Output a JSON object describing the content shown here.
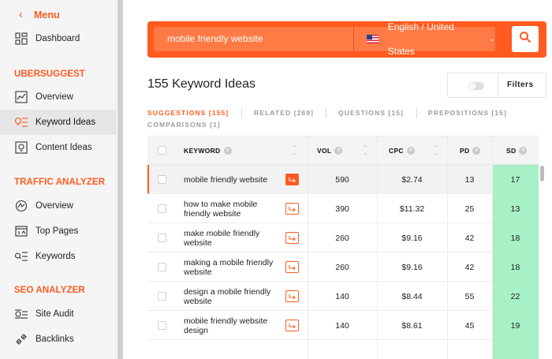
{
  "menu": {
    "label": "Menu"
  },
  "nav": {
    "dashboard": "Dashboard",
    "ubersuggest_title": "UBERSUGGEST",
    "overview": "Overview",
    "keyword_ideas": "Keyword Ideas",
    "content_ideas": "Content Ideas",
    "traffic_title": "TRAFFIC ANALYZER",
    "traffic_overview": "Overview",
    "top_pages": "Top Pages",
    "keywords": "Keywords",
    "seo_title": "SEO ANALYZER",
    "site_audit": "Site Audit",
    "backlinks": "Backlinks"
  },
  "search": {
    "query": "mobile friendly website",
    "language": "English / United States"
  },
  "results": {
    "title": "155 Keyword Ideas",
    "filters_label": "Filters",
    "tabs": [
      "SUGGESTIONS [155]",
      "RELATED [269]",
      "QUESTIONS [15]",
      "PREPOSITIONS [15]",
      "COMPARISONS [1]"
    ]
  },
  "table": {
    "headers": {
      "keyword": "KEYWORD",
      "vol": "VOL",
      "cpc": "CPC",
      "pd": "PD",
      "sd": "SD"
    },
    "rows": [
      {
        "keyword": "mobile friendly website",
        "vol": "590",
        "cpc": "$2.74",
        "pd": "13",
        "sd": "17"
      },
      {
        "keyword": "how to make mobile friendly website",
        "vol": "390",
        "cpc": "$11.32",
        "pd": "25",
        "sd": "13"
      },
      {
        "keyword": "make mobile friendly website",
        "vol": "260",
        "cpc": "$9.16",
        "pd": "42",
        "sd": "18"
      },
      {
        "keyword": "making a mobile friendly website",
        "vol": "260",
        "cpc": "$9.16",
        "pd": "42",
        "sd": "18"
      },
      {
        "keyword": "design a mobile friendly website",
        "vol": "140",
        "cpc": "$8.44",
        "pd": "55",
        "sd": "22"
      },
      {
        "keyword": "mobile friendly website design",
        "vol": "140",
        "cpc": "$8.61",
        "pd": "45",
        "sd": "19"
      }
    ]
  },
  "colors": {
    "accent": "#ff5a1f",
    "sd_green": "#a8f0c6"
  }
}
